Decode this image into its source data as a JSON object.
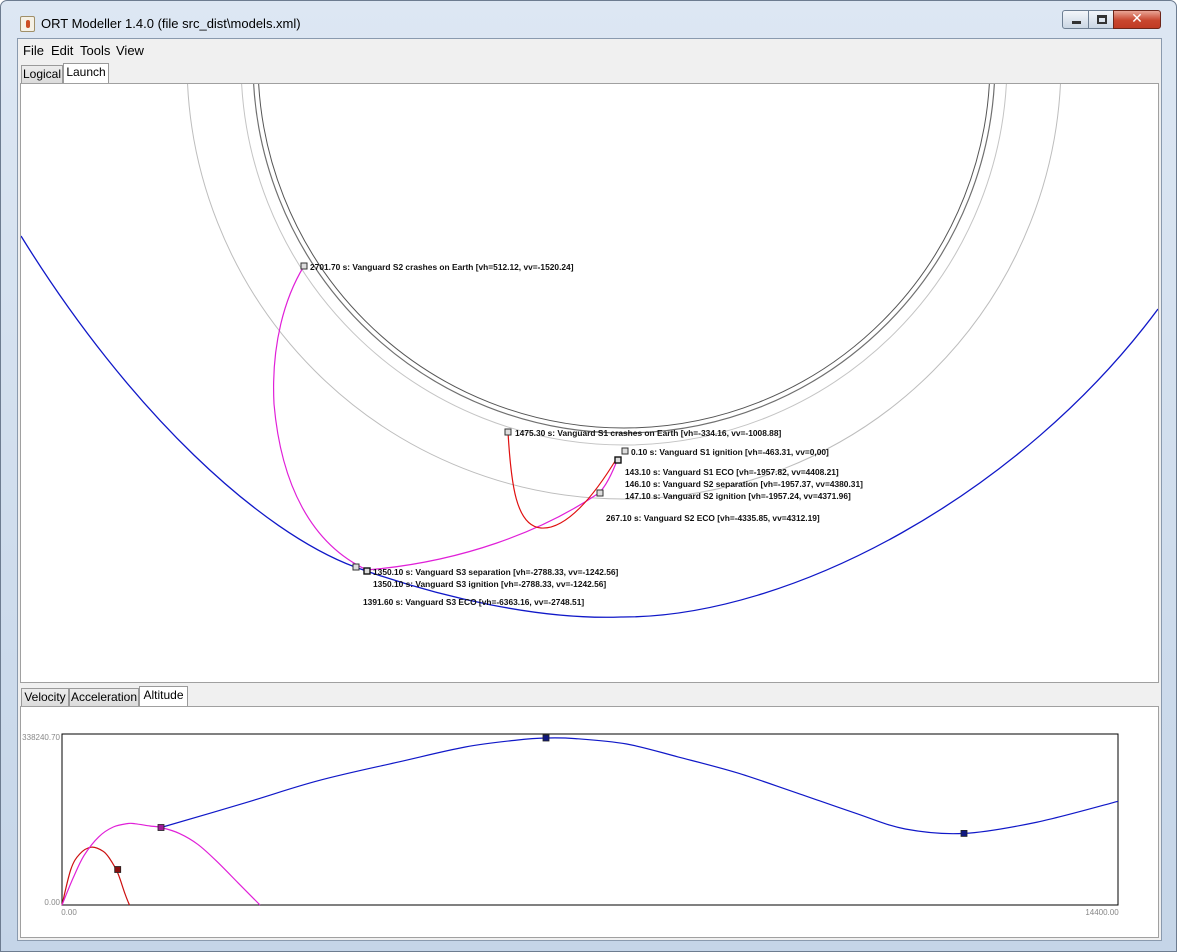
{
  "window": {
    "title": "ORT Modeller 1.4.0 (file src_dist\\models.xml)",
    "close_glyph": "✕"
  },
  "menu": [
    "File",
    "Edit",
    "Tools",
    "View"
  ],
  "main_tabs": [
    {
      "label": "Logical",
      "selected": false
    },
    {
      "label": "Launch",
      "selected": true
    }
  ],
  "events": [
    "2701.70 s: Vanguard S2 crashes on Earth [vh=512.12, vv=-1520.24]",
    "1475.30 s: Vanguard S1 crashes on Earth [vh=-334.16, vv=-1008.88]",
    "0.10 s: Vanguard S1 ignition [vh=-463.31, vv=0,00]",
    "143.10 s: Vanguard S1 ECO [vh=-1957.82, vv=4408.21]",
    "146.10 s: Vanguard S2 separation [vh=-1957.37, vv=4380.31]",
    "147.10 s: Vanguard S2 ignition [vh=-1957.24, vv=4371.96]",
    "267.10 s: Vanguard S2 ECO [vh=-4335.85, vv=4312.19]",
    "1350.10 s: Vanguard S3 separation [vh=-2788.33, vv=-1242.56]",
    "1350.10 s: Vanguard S3 ignition [vh=-2788.33, vv=-1242.56]",
    "1391.60 s: Vanguard S3 ECO [vh=-6363.16, vv=-2748.51]"
  ],
  "trajectory_colors": {
    "stage1": "#e01010",
    "stage2": "#e020d8",
    "stage3": "#1018c8",
    "earth": "#555555",
    "orbit_ref": "#bdbdbd"
  },
  "plot_tabs": [
    {
      "label": "Velocity",
      "selected": false
    },
    {
      "label": "Acceleration",
      "selected": false
    },
    {
      "label": "Altitude",
      "selected": true
    }
  ],
  "chart_data": {
    "type": "line",
    "title": "",
    "xlabel": "",
    "ylabel": "",
    "xlim": [
      0,
      14400
    ],
    "ylim": [
      0,
      338240.7
    ],
    "x_tick_labels": [
      "0.00",
      "14400.00"
    ],
    "y_tick_labels": [
      "0.00",
      "338240.70"
    ],
    "series": [
      {
        "color": "#cc1010",
        "x": [
          0,
          120,
          240,
          400,
          560,
          650,
          760,
          860,
          920
        ],
        "y": [
          0,
          72000,
          103000,
          117000,
          109000,
          94000,
          65000,
          22000,
          0
        ]
      },
      {
        "color": "#e020d8",
        "x": [
          0,
          150,
          300,
          500,
          700,
          900,
          1000,
          1200,
          1350,
          1600,
          1850,
          2100,
          2400,
          2700
        ],
        "y": [
          0,
          54000,
          100000,
          138000,
          158000,
          165000,
          164500,
          160000,
          157000,
          145000,
          123000,
          90000,
          45000,
          0
        ]
      },
      {
        "color": "#1018c8",
        "x": [
          1350,
          2500,
          3500,
          4600,
          5500,
          6200,
          6600,
          7000,
          7700,
          8400,
          9200,
          10000,
          10800,
          11500,
          12300,
          13300,
          14400
        ],
        "y": [
          157000,
          207000,
          252000,
          290000,
          320000,
          334000,
          338240,
          337000,
          326000,
          300000,
          268000,
          228000,
          187000,
          154000,
          145000,
          168000,
          210000
        ]
      }
    ],
    "markers": [
      {
        "color": "#8a1010",
        "x": 760,
        "y": 72000
      },
      {
        "color": "#a01898",
        "x": 1350,
        "y": 157000
      },
      {
        "color": "#101880",
        "x": 6600,
        "y": 338240
      },
      {
        "color": "#101880",
        "x": 12300,
        "y": 145000
      }
    ]
  }
}
